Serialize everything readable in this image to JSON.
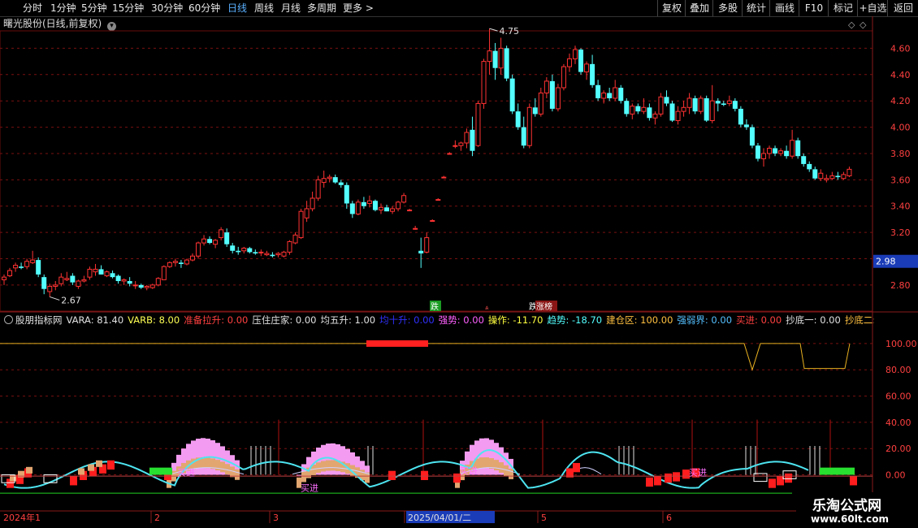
{
  "toolbar": {
    "periods": [
      "分时",
      "1分钟",
      "5分钟",
      "15分钟",
      "30分钟",
      "60分钟",
      "日线",
      "周线",
      "月线",
      "多周期",
      "更多 >"
    ],
    "active_period": "日线",
    "right_buttons": [
      "复权",
      "叠加",
      "多股",
      "统计",
      "画线",
      "F10",
      "标记",
      "+自选",
      "返回"
    ]
  },
  "stock": {
    "title": "曙光股份(日线,前复权)",
    "current_price_tag": "2.98"
  },
  "colors": {
    "up": "#ff3232",
    "down": "#54ffff",
    "grid": "#7a1010",
    "axis_text": "#ff4040",
    "price_tag_bg": "#1a3cb8",
    "yellow_line": "#e8b020",
    "green_bar": "#27e030",
    "pink": "#f39bf0",
    "tan": "#e2a670",
    "cyan_line": "#4de4f0"
  },
  "chart_data": [
    {
      "type": "candlestick",
      "title": "曙光股份(日线,前复权)",
      "ylim": [
        2.62,
        4.72
      ],
      "y_ticks": [
        "4.60",
        "4.40",
        "4.20",
        "4.00",
        "3.80",
        "3.60",
        "3.40",
        "3.20",
        "3.00",
        "2.80"
      ],
      "annotations": {
        "high": "4.75",
        "low": "2.67"
      },
      "signal_labels": [
        "跌",
        "涨",
        "跌",
        "涨榜"
      ],
      "ohlc": [
        [
          2.84,
          2.88,
          2.8,
          2.86
        ],
        [
          2.87,
          2.93,
          2.86,
          2.91
        ],
        [
          2.93,
          2.97,
          2.9,
          2.95
        ],
        [
          2.94,
          2.97,
          2.92,
          2.93
        ],
        [
          2.94,
          3.0,
          2.92,
          2.98
        ],
        [
          2.97,
          3.06,
          2.96,
          2.99
        ],
        [
          2.99,
          3.01,
          2.86,
          2.88
        ],
        [
          2.86,
          2.88,
          2.73,
          2.77
        ],
        [
          2.75,
          2.81,
          2.71,
          2.79
        ],
        [
          2.79,
          2.83,
          2.76,
          2.8
        ],
        [
          2.81,
          2.89,
          2.79,
          2.86
        ],
        [
          2.84,
          2.9,
          2.83,
          2.85
        ],
        [
          2.87,
          2.89,
          2.8,
          2.82
        ],
        [
          2.79,
          2.84,
          2.77,
          2.83
        ],
        [
          2.83,
          2.87,
          2.82,
          2.84
        ],
        [
          2.86,
          2.94,
          2.84,
          2.92
        ],
        [
          2.9,
          2.96,
          2.87,
          2.92
        ],
        [
          2.92,
          2.95,
          2.88,
          2.88
        ],
        [
          2.87,
          2.91,
          2.86,
          2.9
        ],
        [
          2.89,
          2.91,
          2.85,
          2.86
        ],
        [
          2.87,
          2.88,
          2.81,
          2.83
        ],
        [
          2.83,
          2.85,
          2.8,
          2.84
        ],
        [
          2.83,
          2.86,
          2.79,
          2.81
        ],
        [
          2.8,
          2.83,
          2.77,
          2.8
        ],
        [
          2.8,
          2.81,
          2.77,
          2.78
        ],
        [
          2.78,
          2.8,
          2.76,
          2.79
        ],
        [
          2.78,
          2.81,
          2.77,
          2.8
        ],
        [
          2.8,
          2.86,
          2.79,
          2.85
        ],
        [
          2.84,
          2.95,
          2.84,
          2.94
        ],
        [
          2.94,
          2.98,
          2.93,
          2.97
        ],
        [
          2.97,
          3.0,
          2.94,
          2.98
        ],
        [
          2.97,
          2.99,
          2.93,
          2.96
        ],
        [
          2.96,
          3.0,
          2.95,
          2.99
        ],
        [
          2.99,
          3.04,
          2.98,
          3.02
        ],
        [
          3.02,
          3.13,
          3.0,
          3.12
        ],
        [
          3.12,
          3.18,
          3.1,
          3.15
        ],
        [
          3.15,
          3.17,
          3.11,
          3.12
        ],
        [
          3.11,
          3.15,
          3.08,
          3.14
        ],
        [
          3.16,
          3.24,
          3.14,
          3.22
        ],
        [
          3.2,
          3.23,
          3.09,
          3.11
        ],
        [
          3.1,
          3.12,
          3.04,
          3.06
        ],
        [
          3.06,
          3.09,
          3.03,
          3.05
        ],
        [
          3.06,
          3.09,
          3.04,
          3.08
        ],
        [
          3.08,
          3.09,
          3.04,
          3.05
        ],
        [
          3.05,
          3.07,
          3.03,
          3.04
        ],
        [
          3.05,
          3.07,
          3.02,
          3.05
        ],
        [
          3.03,
          3.06,
          3.02,
          3.04
        ],
        [
          3.03,
          3.05,
          3.01,
          3.02
        ],
        [
          3.03,
          3.05,
          3.01,
          3.04
        ],
        [
          3.02,
          3.06,
          3.01,
          3.05
        ],
        [
          3.05,
          3.14,
          3.03,
          3.13
        ],
        [
          3.12,
          3.2,
          3.11,
          3.18
        ],
        [
          3.16,
          3.38,
          3.15,
          3.36
        ],
        [
          3.31,
          3.44,
          3.28,
          3.38
        ],
        [
          3.38,
          3.51,
          3.36,
          3.46
        ],
        [
          3.46,
          3.63,
          3.44,
          3.6
        ],
        [
          3.58,
          3.67,
          3.54,
          3.61
        ],
        [
          3.61,
          3.64,
          3.58,
          3.62
        ],
        [
          3.62,
          3.64,
          3.57,
          3.58
        ],
        [
          3.58,
          3.6,
          3.54,
          3.56
        ],
        [
          3.56,
          3.58,
          3.38,
          3.42
        ],
        [
          3.42,
          3.44,
          3.31,
          3.34
        ],
        [
          3.34,
          3.45,
          3.33,
          3.43
        ],
        [
          3.43,
          3.47,
          3.38,
          3.4
        ],
        [
          3.42,
          3.48,
          3.39,
          3.44
        ],
        [
          3.44,
          3.45,
          3.36,
          3.37
        ],
        [
          3.37,
          3.42,
          3.34,
          3.39
        ],
        [
          3.39,
          3.41,
          3.36,
          3.36
        ],
        [
          3.36,
          3.4,
          3.34,
          3.38
        ],
        [
          3.38,
          3.44,
          3.36,
          3.43
        ],
        [
          3.43,
          3.5,
          3.42,
          3.48
        ],
        [
          3.37,
          3.38,
          3.37,
          3.37
        ],
        [
          3.23,
          3.25,
          3.22,
          3.23
        ],
        [
          3.06,
          3.16,
          2.93,
          3.04
        ],
        [
          3.05,
          3.2,
          3.04,
          3.16
        ],
        [
          3.29,
          3.3,
          3.29,
          3.29
        ],
        [
          3.45,
          3.46,
          3.45,
          3.45
        ],
        [
          3.62,
          3.63,
          3.62,
          3.62
        ],
        [
          3.8,
          3.81,
          3.8,
          3.8
        ],
        [
          3.86,
          3.9,
          3.84,
          3.86
        ],
        [
          3.86,
          3.89,
          3.82,
          3.88
        ],
        [
          3.88,
          3.99,
          3.84,
          3.96
        ],
        [
          3.98,
          4.08,
          3.78,
          3.82
        ],
        [
          3.86,
          4.2,
          3.85,
          4.18
        ],
        [
          4.18,
          4.52,
          4.14,
          4.5
        ],
        [
          4.5,
          4.75,
          4.4,
          4.58
        ],
        [
          4.58,
          4.64,
          4.36,
          4.45
        ],
        [
          4.45,
          4.68,
          4.4,
          4.6
        ],
        [
          4.6,
          4.62,
          4.35,
          4.37
        ],
        [
          4.37,
          4.4,
          4.1,
          4.12
        ],
        [
          4.12,
          4.18,
          3.98,
          4.0
        ],
        [
          4.0,
          4.08,
          3.84,
          3.86
        ],
        [
          3.86,
          4.18,
          3.84,
          4.15
        ],
        [
          4.15,
          4.22,
          4.08,
          4.1
        ],
        [
          4.1,
          4.3,
          4.08,
          4.26
        ],
        [
          4.26,
          4.38,
          4.22,
          4.35
        ],
        [
          4.35,
          4.4,
          4.12,
          4.14
        ],
        [
          4.14,
          4.33,
          4.12,
          4.3
        ],
        [
          4.3,
          4.48,
          4.28,
          4.46
        ],
        [
          4.46,
          4.56,
          4.42,
          4.52
        ],
        [
          4.52,
          4.62,
          4.48,
          4.59
        ],
        [
          4.59,
          4.6,
          4.4,
          4.42
        ],
        [
          4.42,
          4.5,
          4.36,
          4.48
        ],
        [
          4.48,
          4.55,
          4.3,
          4.32
        ],
        [
          4.32,
          4.36,
          4.2,
          4.22
        ],
        [
          4.22,
          4.28,
          4.18,
          4.26
        ],
        [
          4.26,
          4.3,
          4.2,
          4.22
        ],
        [
          4.22,
          4.36,
          4.2,
          4.3
        ],
        [
          4.3,
          4.32,
          4.18,
          4.2
        ],
        [
          4.2,
          4.22,
          4.08,
          4.1
        ],
        [
          4.1,
          4.18,
          4.06,
          4.16
        ],
        [
          4.16,
          4.18,
          4.1,
          4.12
        ],
        [
          4.12,
          4.22,
          4.1,
          4.15
        ],
        [
          4.15,
          4.18,
          4.05,
          4.07
        ],
        [
          4.07,
          4.12,
          4.02,
          4.1
        ],
        [
          4.1,
          4.26,
          4.08,
          4.23
        ],
        [
          4.23,
          4.28,
          4.16,
          4.18
        ],
        [
          4.18,
          4.2,
          4.04,
          4.05
        ],
        [
          4.05,
          4.16,
          4.02,
          4.12
        ],
        [
          4.12,
          4.2,
          4.08,
          4.15
        ],
        [
          4.15,
          4.26,
          4.1,
          4.22
        ],
        [
          4.22,
          4.24,
          4.1,
          4.12
        ],
        [
          4.12,
          4.24,
          4.1,
          4.22
        ],
        [
          4.22,
          4.24,
          4.04,
          4.05
        ],
        [
          4.05,
          4.32,
          4.03,
          4.2
        ],
        [
          4.2,
          4.22,
          4.12,
          4.18
        ],
        [
          4.18,
          4.2,
          4.16,
          4.17
        ],
        [
          4.18,
          4.24,
          4.16,
          4.2
        ],
        [
          4.2,
          4.22,
          4.12,
          4.14
        ],
        [
          4.14,
          4.16,
          4.0,
          4.02
        ],
        [
          4.02,
          4.06,
          3.98,
          4.0
        ],
        [
          4.0,
          4.02,
          3.84,
          3.86
        ],
        [
          3.86,
          3.88,
          3.74,
          3.76
        ],
        [
          3.76,
          3.84,
          3.7,
          3.8
        ],
        [
          3.8,
          3.86,
          3.76,
          3.84
        ],
        [
          3.84,
          3.86,
          3.78,
          3.8
        ],
        [
          3.8,
          3.84,
          3.78,
          3.82
        ],
        [
          3.82,
          3.86,
          3.76,
          3.78
        ],
        [
          3.78,
          3.98,
          3.76,
          3.9
        ],
        [
          3.9,
          3.92,
          3.76,
          3.78
        ],
        [
          3.78,
          3.8,
          3.7,
          3.72
        ],
        [
          3.72,
          3.74,
          3.66,
          3.68
        ],
        [
          3.68,
          3.7,
          3.6,
          3.61
        ],
        [
          3.61,
          3.68,
          3.59,
          3.65
        ],
        [
          3.6,
          3.64,
          3.58,
          3.61
        ],
        [
          3.61,
          3.66,
          3.6,
          3.63
        ],
        [
          3.63,
          3.66,
          3.6,
          3.62
        ],
        [
          3.61,
          3.66,
          3.6,
          3.64
        ],
        [
          3.63,
          3.7,
          3.62,
          3.68
        ]
      ]
    },
    {
      "type": "indicator",
      "name": "股朋指标网",
      "ylim": [
        -17,
        108
      ],
      "y_ticks": [
        "100.00",
        "80.00",
        "60.00",
        "40.00",
        "20.00",
        "0.00"
      ],
      "fields": [
        {
          "label": "VARA",
          "value": "81.40"
        },
        {
          "label": "VARB",
          "value": "8.00"
        },
        {
          "label": "准备拉升",
          "value": "0.00"
        },
        {
          "label": "压住庄家",
          "value": "0.00"
        },
        {
          "label": "均五升",
          "value": "1.00"
        },
        {
          "label": "均十升",
          "value": "0.00"
        },
        {
          "label": "强势",
          "value": "0.00"
        },
        {
          "label": "操作",
          "value": "-11.70"
        },
        {
          "label": "趋势",
          "value": "-18.70"
        },
        {
          "label": "建仓区",
          "value": "100.00"
        },
        {
          "label": "强弱界",
          "value": "0.00"
        },
        {
          "label": "买进",
          "value": "0.00"
        },
        {
          "label": "抄底一",
          "value": "0.00"
        },
        {
          "label": "抄底二",
          "value": "0.00"
        }
      ],
      "buy_labels": [
        "买进",
        "买进",
        "买进",
        "买进",
        "买进"
      ]
    }
  ],
  "xaxis": {
    "labels": [
      "2024年1",
      "2",
      "3",
      "2025/04/01/二",
      "5",
      "6"
    ]
  },
  "watermark": {
    "name": "乐淘公式网",
    "url": "www.60lt.com"
  }
}
